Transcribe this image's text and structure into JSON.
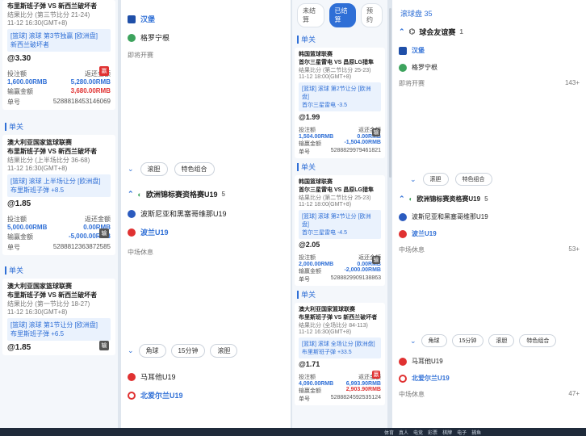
{
  "col1": {
    "top": {
      "teams": "布里斯班子弹 VS 新西兰破坏者",
      "result": "结果比分 (第三节比分 21-24)",
      "time": "11-12 16:30(GMT+8)",
      "bet_line": "[篮球] 滚球 第3节独赢 [欧洲盘]",
      "pick": "新西兰破坏者",
      "odds": "@3.30",
      "stake_l": "投注额",
      "stake_v": "1,600.00RMB",
      "ret_l": "返还金额",
      "ret_v": "5,280.00RMB",
      "win_l": "输赢金额",
      "win_v": "3,680.00RMB",
      "no_l": "单号",
      "no_v": "5288818453146069"
    },
    "s1": {
      "label": "单关",
      "league": "澳大利亚国家篮球联赛",
      "teams": "布里斯班子弹 VS 新西兰破坏者",
      "result": "结果比分 (上半场比分 36-68)",
      "time": "11-12 16:30(GMT+8)",
      "bet_line": "[篮球] 滚球 上半场让分 [欧洲盘]",
      "pick": "布里斯班子弹 +8.5",
      "odds": "@1.85",
      "stake_l": "投注额",
      "stake_v": "5,000.00RMB",
      "ret_l": "返还金额",
      "ret_v": "0.00RMB",
      "win_l": "输赢金额",
      "win_v": "-5,000.00RMB",
      "no_l": "单号",
      "no_v": "5288812363872585"
    },
    "s2": {
      "label": "单关",
      "league": "澳大利亚国家篮球联赛",
      "teams": "布里斯班子弹 VS 新西兰破坏者",
      "result": "结果比分 (第一节比分 18-27)",
      "time": "11-12 16:30(GMT+8)",
      "bet_line": "[篮球] 滚球 第1节让分 [欧洲盘]",
      "pick": "布里斯班子弹 +6.5",
      "odds": "@1.85"
    }
  },
  "col2": {
    "teamA": "汉堡",
    "teamB": "格罗宁根",
    "status": "即将开赛",
    "pills": [
      "滚胆",
      "特色组合"
    ],
    "m2": {
      "title": "欧洲锦标赛资格赛U19",
      "count": "5",
      "teamA": "波斯尼亚和黑塞哥维那U19",
      "teamB": "波兰U19",
      "status": "中场休息"
    },
    "pills2": [
      "角球",
      "15分钟",
      "滚胆"
    ],
    "m3": {
      "teamA": "马耳他U19",
      "teamB": "北爱尔兰U19"
    }
  },
  "col3": {
    "tabs": [
      "未结算",
      "已结算",
      "预约"
    ],
    "b1": {
      "label": "单关",
      "league": "韩国篮球联赛",
      "teams": "首尔三星雷电 VS 昌原LG猎隼",
      "result": "结果比分 (第二节比分 25-23)",
      "time": "11-12 18:00(GMT+8)",
      "bet_line": "[篮球] 滚球 第2节让分 [欧洲盘]",
      "pick": "首尔三星雷电 -3.5",
      "odds": "@1.99",
      "stake_l": "投注额",
      "stake_v": "1,504.00RMB",
      "ret_l": "返还金额",
      "ret_v": "0.00RMB",
      "win_l": "输赢金额",
      "win_v": "-1,504.00RMB",
      "no_l": "单号",
      "no_v": "5288829979461821"
    },
    "b2": {
      "label": "单关",
      "league": "韩国篮球联赛",
      "teams": "首尔三星雷电 VS 昌原LG猎隼",
      "result": "结果比分 (第二节比分 25-23)",
      "time": "11-12 18:00(GMT+8)",
      "bet_line": "[篮球] 滚球 第2节让分 [欧洲盘]",
      "pick": "首尔三星雷电 -4.5",
      "odds": "@2.05",
      "stake_l": "投注额",
      "stake_v": "2,000.00RMB",
      "ret_l": "返还金额",
      "ret_v": "0.00RMB",
      "win_l": "输赢金额",
      "win_v": "-2,000.00RMB",
      "no_l": "单号",
      "no_v": "5288829909138863"
    },
    "b3": {
      "label": "单关",
      "league": "澳大利亚国家篮球联赛",
      "teams": "布里斯班子弹 VS 新西兰破坏者",
      "result": "结果比分 (全场比分 84-113)",
      "time": "11-12 16:30(GMT+8)",
      "bet_line": "[篮球] 滚球 全场让分 [欧洲盘]",
      "pick": "布里斯班子弹 +33.5",
      "odds": "@1.71",
      "stake_l": "投注额",
      "stake_v": "4,090.00RMB",
      "ret_l": "返还金额",
      "ret_v": "6,993.90RMB",
      "win_l": "输赢金额",
      "win_v": "2,903.90RMB",
      "no_l": "单号",
      "no_v": "5288824592535124"
    }
  },
  "col4": {
    "header": "滚球盘 35",
    "m1": {
      "title": "球会友谊赛",
      "count": "1",
      "teamA": "汉堡",
      "teamB": "格罗宁根",
      "status": "即将开赛",
      "more": "143+"
    },
    "pills": [
      "滚胆",
      "特色组合"
    ],
    "m2": {
      "title": "欧洲锦标赛资格赛U19",
      "count": "5",
      "teamA": "波斯尼亚和黑塞哥维那U19",
      "teamB": "波兰U19",
      "status": "中场休息",
      "more": "53+"
    },
    "pills2": [
      "角球",
      "15分钟",
      "滚胆",
      "特色组合"
    ],
    "m3": {
      "teamA": "马耳他U19",
      "teamB": "北爱尔兰U19",
      "status": "中场休息",
      "more": "47+"
    }
  },
  "taskbar": [
    "体育",
    "真人",
    "电竞",
    "彩票",
    "棋牌",
    "电子",
    "捕鱼"
  ]
}
